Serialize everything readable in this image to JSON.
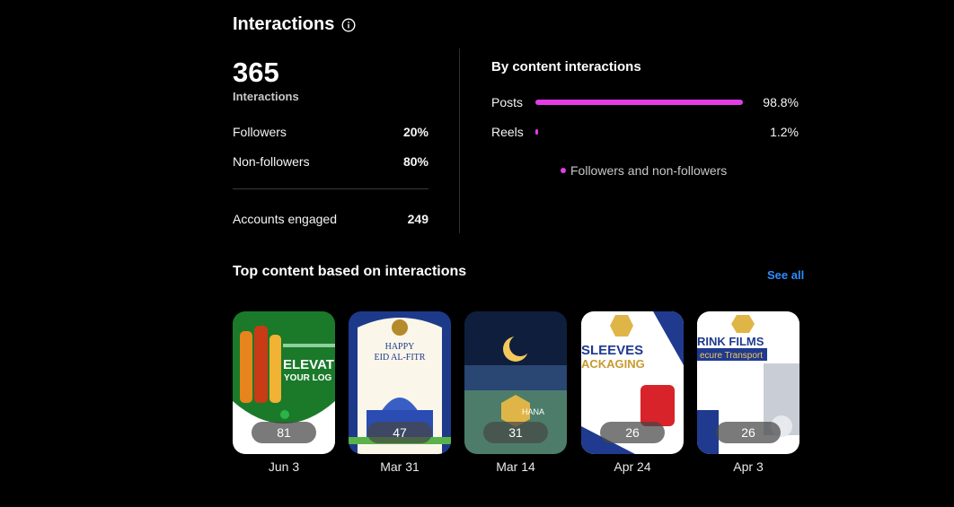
{
  "header": {
    "title": "Interactions",
    "info_icon": "info-circle-icon"
  },
  "summary": {
    "total": "365",
    "total_label": "Interactions",
    "followers_label": "Followers",
    "followers_value": "20%",
    "nonfollowers_label": "Non-followers",
    "nonfollowers_value": "80%",
    "accounts_label": "Accounts engaged",
    "accounts_value": "249"
  },
  "by_content": {
    "title": "By content interactions",
    "accent": "#e33ce8",
    "items": [
      {
        "label": "Posts",
        "pct": "98.8%",
        "value": 98.8
      },
      {
        "label": "Reels",
        "pct": "1.2%",
        "value": 1.2
      }
    ],
    "legend": "Followers and non-followers"
  },
  "top_content": {
    "title": "Top content based on interactions",
    "see_all": "See all",
    "link_color": "#2d8dff",
    "items": [
      {
        "count": "81",
        "date": "Jun 3",
        "thumb_text": "ELEVAT",
        "thumb_sub": "YOUR LOG"
      },
      {
        "count": "47",
        "date": "Mar 31",
        "thumb_text": "HAPPY",
        "thumb_sub": "EID AL-FITR"
      },
      {
        "count": "31",
        "date": "Mar 14",
        "thumb_text": "HANA",
        "thumb_sub": ""
      },
      {
        "count": "26",
        "date": "Apr 24",
        "thumb_text": "SLEEVES",
        "thumb_sub": "ACKAGING"
      },
      {
        "count": "26",
        "date": "Apr 3",
        "thumb_text": "RINK FILMS",
        "thumb_sub": "ecure Transport"
      }
    ]
  }
}
